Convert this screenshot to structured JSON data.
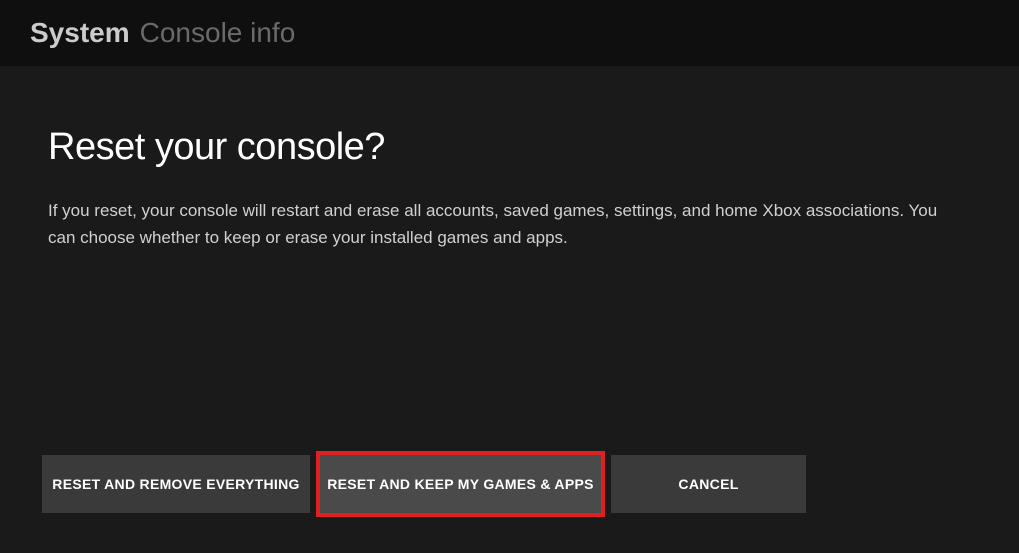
{
  "header": {
    "primary": "System",
    "secondary": "Console info"
  },
  "dialog": {
    "title": "Reset your console?",
    "description": "If you reset, your console will restart and erase all accounts, saved games, settings, and home Xbox associations. You can choose whether to keep or erase your installed games and apps."
  },
  "buttons": {
    "reset_all": "RESET AND REMOVE EVERYTHING",
    "reset_keep": "RESET AND KEEP MY GAMES & APPS",
    "cancel": "CANCEL"
  }
}
